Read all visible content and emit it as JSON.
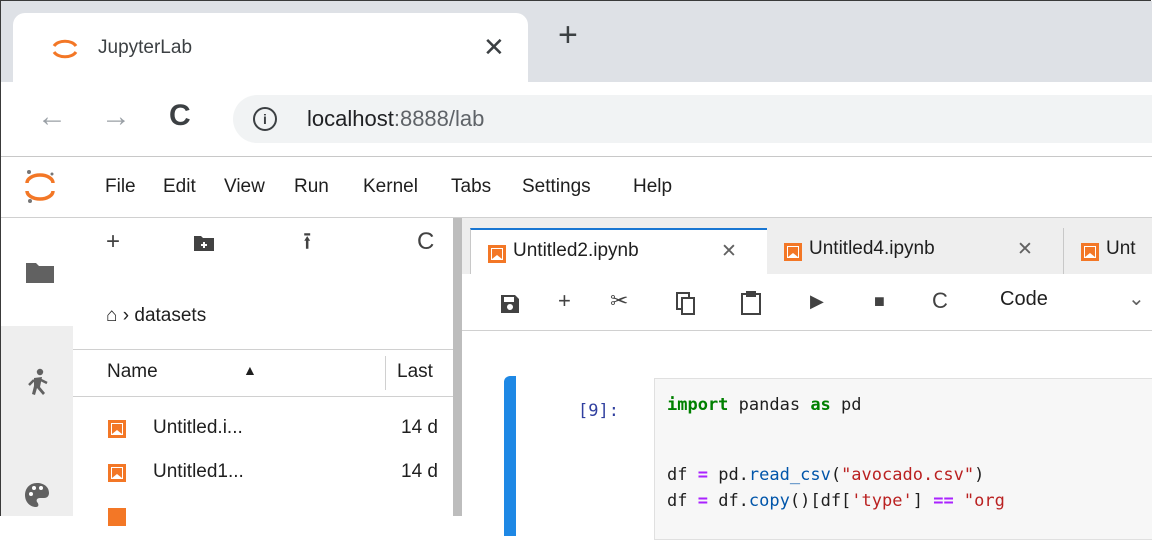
{
  "browser": {
    "tab_title": "JupyterLab",
    "tab_close": "✕",
    "new_tab": "+",
    "url_host": "localhost",
    "url_rest": ":8888/lab"
  },
  "menu": [
    "File",
    "Edit",
    "View",
    "Run",
    "Kernel",
    "Tabs",
    "Settings",
    "Help"
  ],
  "filebrowser": {
    "toolbar": {
      "new_launcher": "+",
      "upload": "⭱",
      "refresh": "C"
    },
    "breadcrumb": "datasets",
    "column_name": "Name",
    "column_last": "Last",
    "files": [
      {
        "name": "Untitled.i...",
        "modified": "14 d"
      },
      {
        "name": "Untitled1...",
        "modified": "14 d"
      }
    ]
  },
  "dock": {
    "tabs": [
      {
        "title": "Untitled2.ipynb",
        "close": "✕"
      },
      {
        "title": "Untitled4.ipynb",
        "close": "✕"
      },
      {
        "title": "Unt"
      }
    ],
    "toolbar": {
      "cell_type": "Code",
      "caret": "⌄"
    },
    "cell": {
      "prompt": "[9]:",
      "line1": {
        "kw1": "import",
        "mod": " pandas ",
        "kw2": "as",
        "alias": " pd"
      },
      "line3": {
        "var": "df ",
        "eq": "=",
        "obj": " pd.",
        "fn": "read_csv",
        "open": "(",
        "str": "\"avocado.csv\"",
        "close": ")"
      },
      "line4": {
        "var": "df ",
        "eq": "=",
        "obj": " df.",
        "fn": "copy",
        "rest": "()[df[",
        "str": "'type'",
        "rest2": "] ",
        "eq2": "==",
        "str2": " \"org"
      }
    }
  },
  "colors": {
    "jupyter_orange": "#f37726",
    "accent_blue": "#1976d2"
  }
}
